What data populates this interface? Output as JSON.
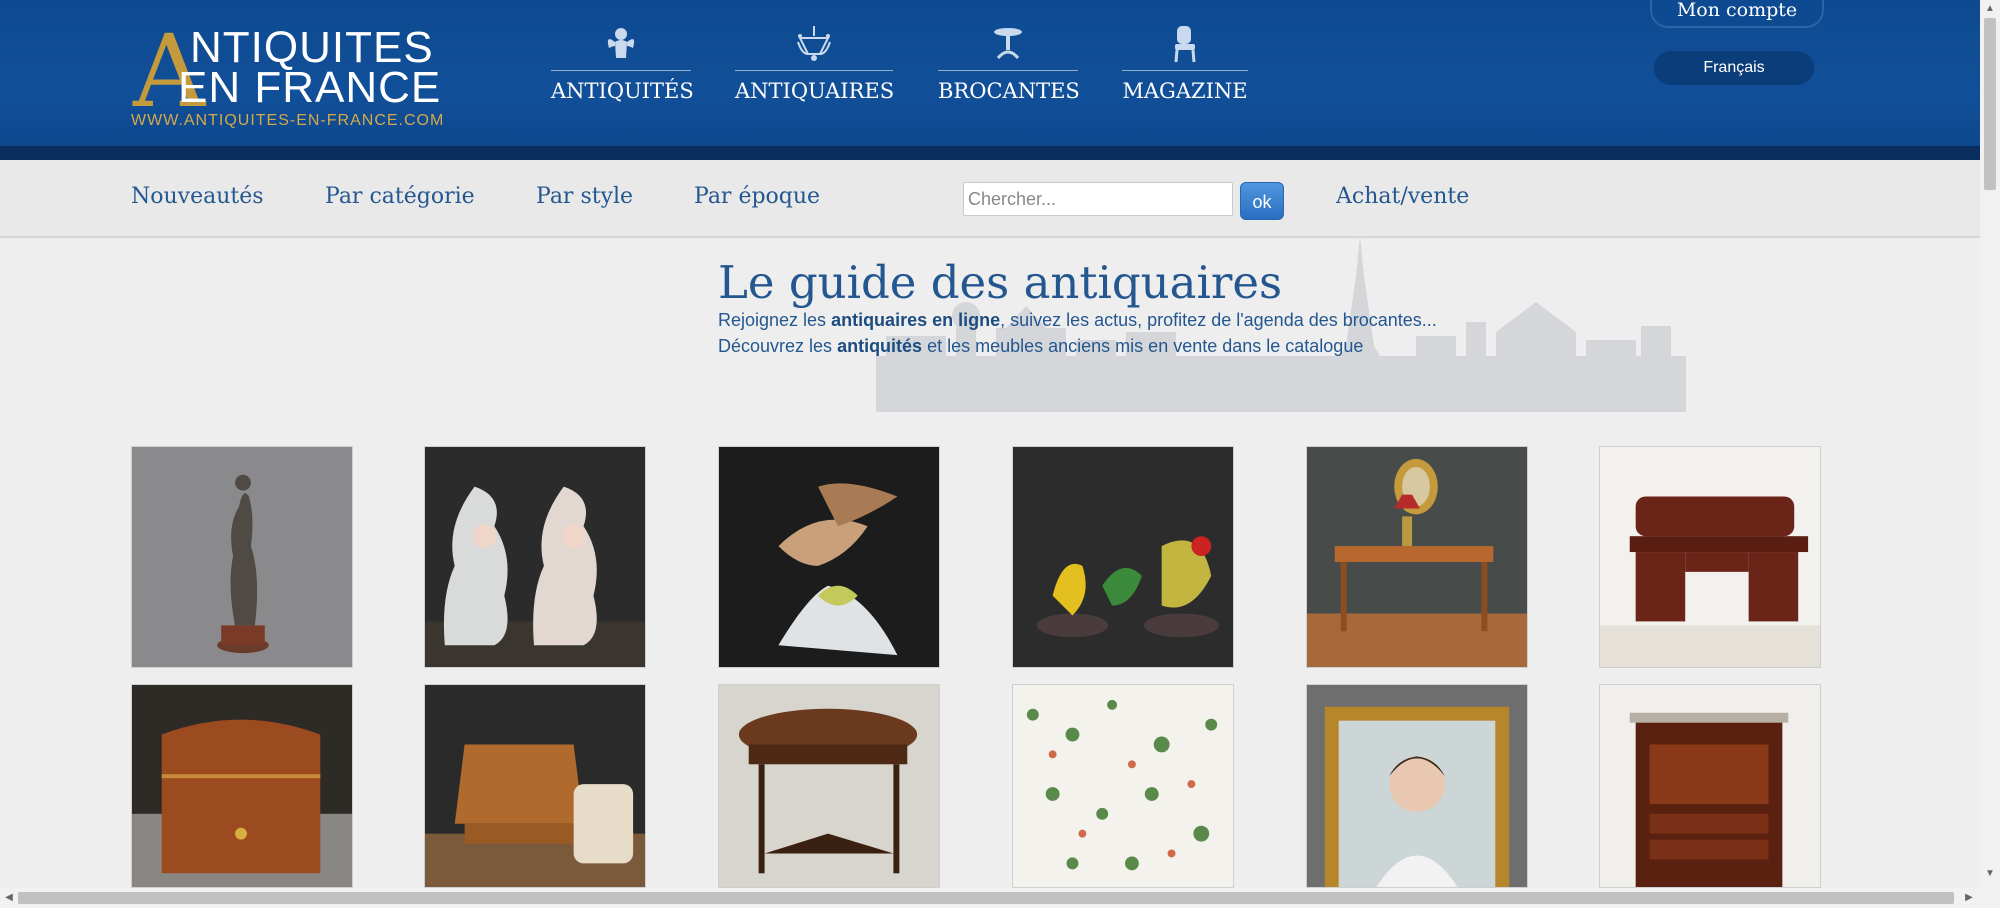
{
  "site": {
    "logo_a": "A",
    "logo_line1": "NTIQUITES",
    "logo_line2": "EN FRANCE",
    "logo_url": "WWW.ANTIQUITES-EN-FRANCE.COM"
  },
  "main_nav": [
    {
      "label": "ANTIQUITÉS",
      "icon": "cherub-icon"
    },
    {
      "label": "ANTIQUAIRES",
      "icon": "chandelier-icon"
    },
    {
      "label": "BROCANTES",
      "icon": "pedestal-table-icon"
    },
    {
      "label": "MAGAZINE",
      "icon": "chair-icon"
    }
  ],
  "account": {
    "label": "Mon compte"
  },
  "language": {
    "label": "Français"
  },
  "sub_nav": {
    "items": [
      "Nouveautés",
      "Par catégorie",
      "Par style",
      "Par époque"
    ],
    "search_placeholder": "Chercher...",
    "search_button": "ok",
    "buy_sell": "Achat/vente"
  },
  "hero": {
    "title": "Le guide des antiquaires",
    "line1_pre": "Rejoignez les ",
    "line1_bold": "antiquaires en ligne",
    "line1_post": ", suivez les actus, profitez de l'agenda des brocantes...",
    "line2_pre": "Découvrez les ",
    "line2_bold": "antiquités",
    "line2_post": " et les meubles anciens mis en vente dans le catalogue"
  },
  "colors": {
    "header_blue": "#0d4a91",
    "link_blue": "#24578f",
    "gold": "#c49a3c"
  },
  "products": [
    {
      "name": "bronze-statue-thumb"
    },
    {
      "name": "porcelain-vases-thumb"
    },
    {
      "name": "porcelain-bird-thumb"
    },
    {
      "name": "bird-figurines-thumb"
    },
    {
      "name": "writing-desk-thumb"
    },
    {
      "name": "roll-top-desk-thumb"
    },
    {
      "name": "leather-box-thumb"
    },
    {
      "name": "marquetry-secretary-thumb"
    },
    {
      "name": "napoleon-table-thumb"
    },
    {
      "name": "floral-wallpaper-thumb"
    },
    {
      "name": "portrait-painting-thumb"
    },
    {
      "name": "secretaire-cabinet-thumb"
    }
  ]
}
